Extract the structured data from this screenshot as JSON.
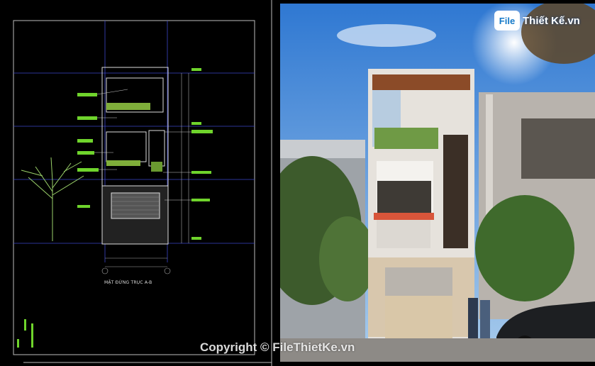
{
  "cad_drawing": {
    "caption": "MẶT ĐỨNG TRỤC A-B"
  },
  "render": {
    "logo": {
      "badge": "File",
      "text": "Thiết Kế.vn"
    }
  },
  "watermark": "Copyright © FileThietKe.vn",
  "colors": {
    "cad_background": "#000000",
    "cad_grid_blue": "#3b46c9",
    "cad_annotation_green": "#6fd42c",
    "sky_blue": "#3f86d8",
    "facade_white": "#ece9e4",
    "logo_blue": "#1479c8"
  }
}
